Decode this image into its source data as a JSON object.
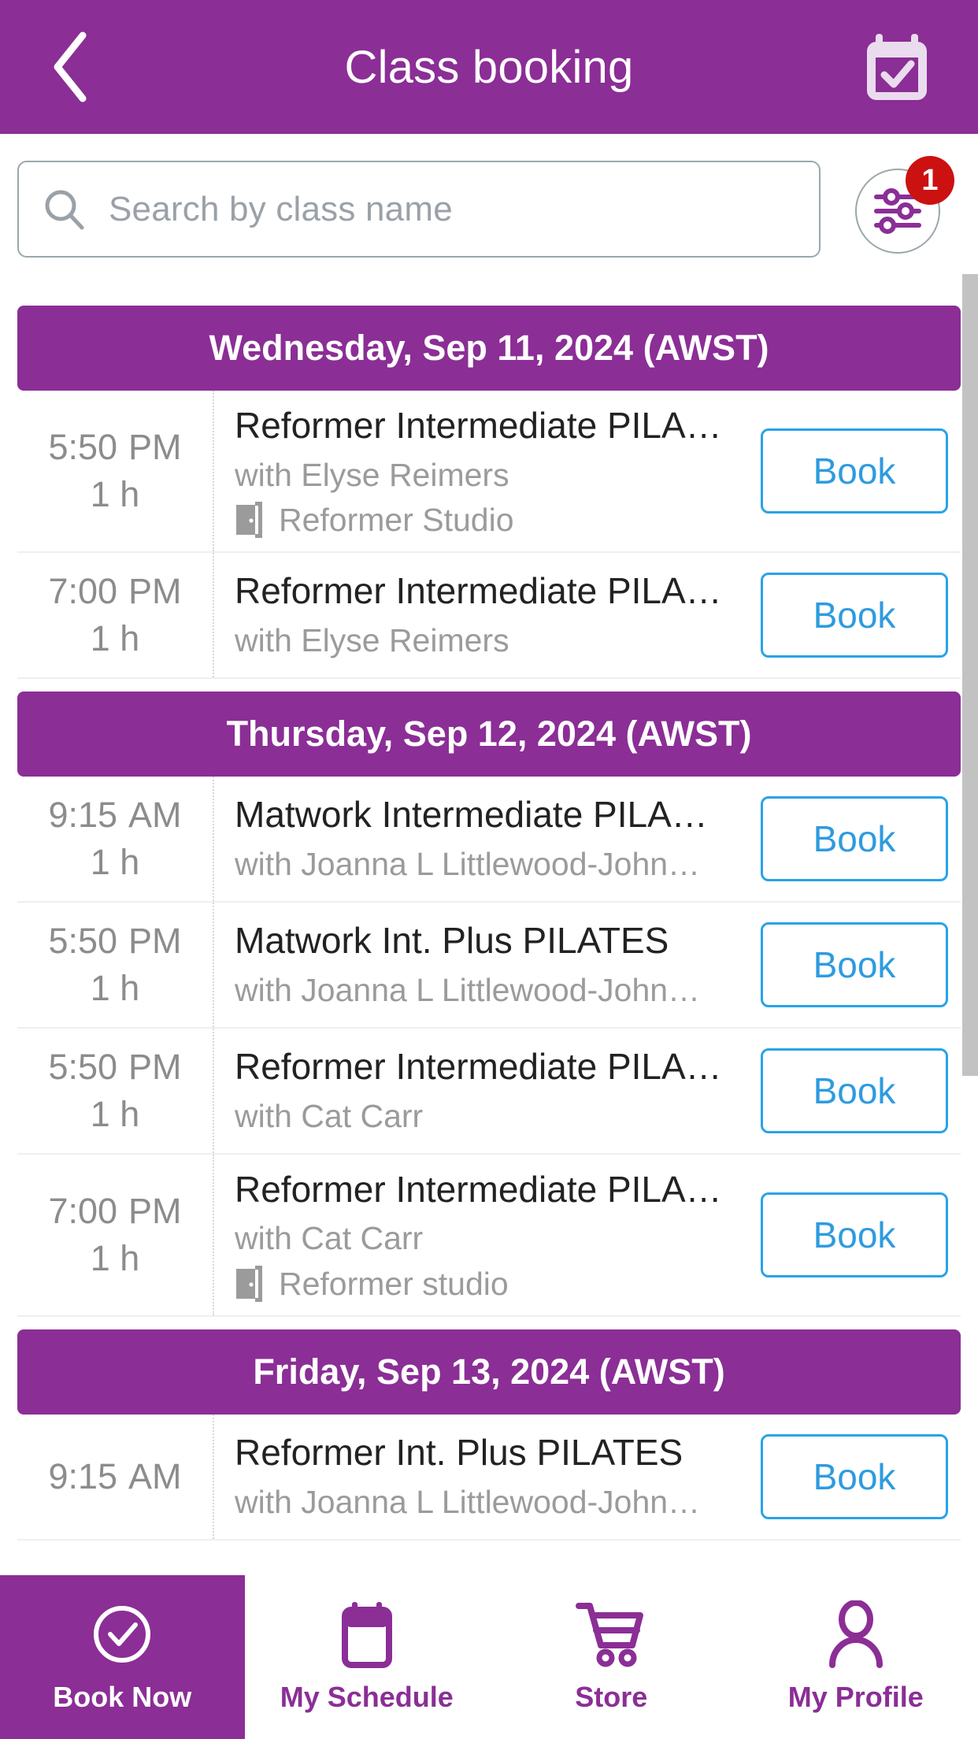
{
  "header": {
    "title": "Class booking",
    "back_icon": "chevron-left-icon",
    "calendar_icon": "calendar-check-icon",
    "background_color": "#8B2E96"
  },
  "search": {
    "placeholder": "Search by class name",
    "value": "",
    "icon": "search-icon",
    "filter_icon": "sliders-filter-icon",
    "filter_badge_count": "1",
    "badge_color": "#CC1111"
  },
  "book_label": "Book",
  "room_icon": "door-room-icon",
  "days": [
    {
      "title": "Wednesday, Sep 11, 2024 (AWST)",
      "classes": [
        {
          "time": "5:50",
          "ampm": "PM",
          "duration": "1 h",
          "name": "Reformer Intermediate PILA…",
          "instructor": "with Elyse Reimers",
          "room": "Reformer Studio",
          "action": "Book"
        },
        {
          "time": "7:00",
          "ampm": "PM",
          "duration": "1 h",
          "name": "Reformer Intermediate PILA…",
          "instructor": "with Elyse Reimers",
          "room": "",
          "action": "Book"
        }
      ]
    },
    {
      "title": "Thursday, Sep 12, 2024 (AWST)",
      "classes": [
        {
          "time": "9:15",
          "ampm": "AM",
          "duration": "1 h",
          "name": "Matwork Intermediate PILA…",
          "instructor": "with Joanna L Littlewood-John…",
          "room": "",
          "action": "Book"
        },
        {
          "time": "5:50",
          "ampm": "PM",
          "duration": "1 h",
          "name": "Matwork Int. Plus PILATES",
          "instructor": "with Joanna L Littlewood-John…",
          "room": "",
          "action": "Book"
        },
        {
          "time": "5:50",
          "ampm": "PM",
          "duration": "1 h",
          "name": "Reformer Intermediate PILA…",
          "instructor": "with Cat Carr",
          "room": "",
          "action": "Book"
        },
        {
          "time": "7:00",
          "ampm": "PM",
          "duration": "1 h",
          "name": "Reformer Intermediate PILA…",
          "instructor": "with Cat Carr",
          "room": "Reformer studio",
          "action": "Book"
        }
      ]
    },
    {
      "title": "Friday, Sep 13, 2024 (AWST)",
      "classes": [
        {
          "time": "9:15",
          "ampm": "AM",
          "duration": "",
          "name": "Reformer Int. Plus PILATES",
          "instructor": "with Joanna L Littlewood-John…",
          "room": "",
          "action": "Book"
        }
      ]
    }
  ],
  "bottom_nav": {
    "items": [
      {
        "label": "Book Now",
        "icon": "check-circle-icon",
        "active": true
      },
      {
        "label": "My Schedule",
        "icon": "calendar-icon",
        "active": false
      },
      {
        "label": "Store",
        "icon": "shopping-cart-icon",
        "active": false
      },
      {
        "label": "My Profile",
        "icon": "person-icon",
        "active": false
      }
    ],
    "accent_color": "#8B2E96"
  }
}
